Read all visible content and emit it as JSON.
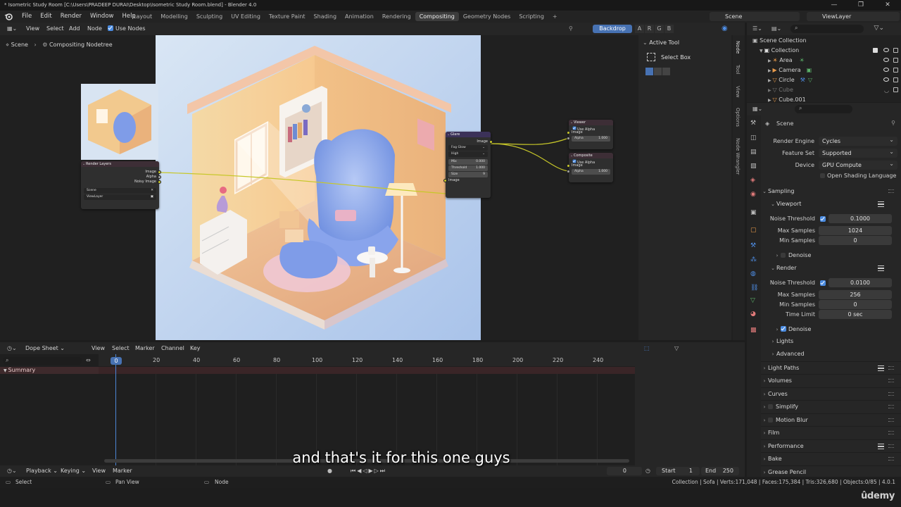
{
  "window": {
    "title": "* Isometric Study Room [C:\\Users\\PRADEEP DURAI\\Desktop\\Isometric Study Room.blend] - Blender 4.0",
    "controls": [
      "—",
      "❐",
      "✕"
    ]
  },
  "menu": [
    "File",
    "Edit",
    "Render",
    "Window",
    "Help"
  ],
  "workspaces": [
    "Layout",
    "Modelling",
    "Sculpting",
    "UV Editing",
    "Texture Paint",
    "Shading",
    "Animation",
    "Rendering",
    "Compositing",
    "Geometry Nodes",
    "Scripting"
  ],
  "active_workspace": "Compositing",
  "scene_name": "Scene",
  "view_layer": "ViewLayer",
  "node_editor": {
    "menus": [
      "View",
      "Select",
      "Add",
      "Node"
    ],
    "use_nodes_label": "Use Nodes",
    "backdrop_label": "Backdrop",
    "channels": [
      "A",
      "R",
      "G",
      "B"
    ],
    "breadcrumb": [
      "Scene",
      "Compositing Nodetree"
    ]
  },
  "nodes": {
    "render_layers": {
      "title": "Render Layers",
      "outputs": [
        "Image",
        "Alpha",
        "Noisy Image"
      ],
      "scene": "Scene",
      "layer": "ViewLayer"
    },
    "glare": {
      "title": "Glare",
      "input": "Image",
      "output": "Image",
      "type": "Fog Glow",
      "quality": "High",
      "mix_label": "Mix",
      "mix_value": "0.000",
      "threshold_label": "Threshold",
      "threshold_value": "1.000",
      "size_label": "Size",
      "size_value": "9"
    },
    "viewer": {
      "title": "Viewer",
      "use_alpha": "Use Alpha",
      "image": "Image",
      "alpha_label": "Alpha",
      "alpha_value": "1.000"
    },
    "composite": {
      "title": "Composite",
      "use_alpha": "Use Alpha",
      "image": "Image",
      "alpha_label": "Alpha",
      "alpha_value": "1.000"
    }
  },
  "n_panel": {
    "header": "Active Tool",
    "tool": "Select Box",
    "tabs": [
      "Node",
      "Tool",
      "View",
      "Options",
      "Node Wrangler"
    ]
  },
  "timeline": {
    "editor": "Dope Sheet",
    "menus": [
      "View",
      "Select",
      "Marker",
      "Channel",
      "Key"
    ],
    "summary": "Summary",
    "current_frame": "0",
    "ticks": [
      "20",
      "40",
      "60",
      "80",
      "100",
      "120",
      "140",
      "160",
      "180",
      "200",
      "220",
      "240"
    ]
  },
  "playback": {
    "menus": [
      "Playback",
      "Keying",
      "View",
      "Marker"
    ],
    "frame": "0",
    "start_label": "Start",
    "start": "1",
    "end_label": "End",
    "end": "250"
  },
  "status": {
    "select": "Select",
    "pan": "Pan View",
    "node": "Node",
    "stats": "Collection | Sofa | Verts:171,048 | Faces:175,384 | Tris:326,680 | Objects:0/85 | 4.0.1"
  },
  "outliner": {
    "root": "Scene Collection",
    "collection": "Collection",
    "items": [
      "Area",
      "Camera",
      "Circle",
      "Cube",
      "Cube.001"
    ]
  },
  "properties": {
    "scene_label": "Scene",
    "render_engine_label": "Render Engine",
    "render_engine": "Cycles",
    "feature_set_label": "Feature Set",
    "feature_set": "Supported",
    "device_label": "Device",
    "device": "GPU Compute",
    "osl_label": "Open Shading Language",
    "sampling": "Sampling",
    "viewport": "Viewport",
    "vp_noise_label": "Noise Threshold",
    "vp_noise": "0.1000",
    "vp_max_label": "Max Samples",
    "vp_max": "1024",
    "vp_min_label": "Min Samples",
    "vp_min": "0",
    "denoise": "Denoise",
    "render": "Render",
    "r_noise_label": "Noise Threshold",
    "r_noise": "0.0100",
    "r_max_label": "Max Samples",
    "r_max": "256",
    "r_min_label": "Min Samples",
    "r_min": "0",
    "time_limit_label": "Time Limit",
    "time_limit": "0 sec",
    "r_denoise": "Denoise",
    "lights": "Lights",
    "advanced": "Advanced",
    "light_paths": "Light Paths",
    "volumes": "Volumes",
    "curves": "Curves",
    "simplify": "Simplify",
    "motion_blur": "Motion Blur",
    "film": "Film",
    "performance": "Performance",
    "bake": "Bake",
    "grease_pencil": "Grease Pencil"
  },
  "subtitle": "and that's it for this one guys",
  "watermark": "ûdemy",
  "colors": {
    "accent": "#4772b3",
    "socket_color": "#c7c729",
    "summary_row": "#3a2527"
  }
}
